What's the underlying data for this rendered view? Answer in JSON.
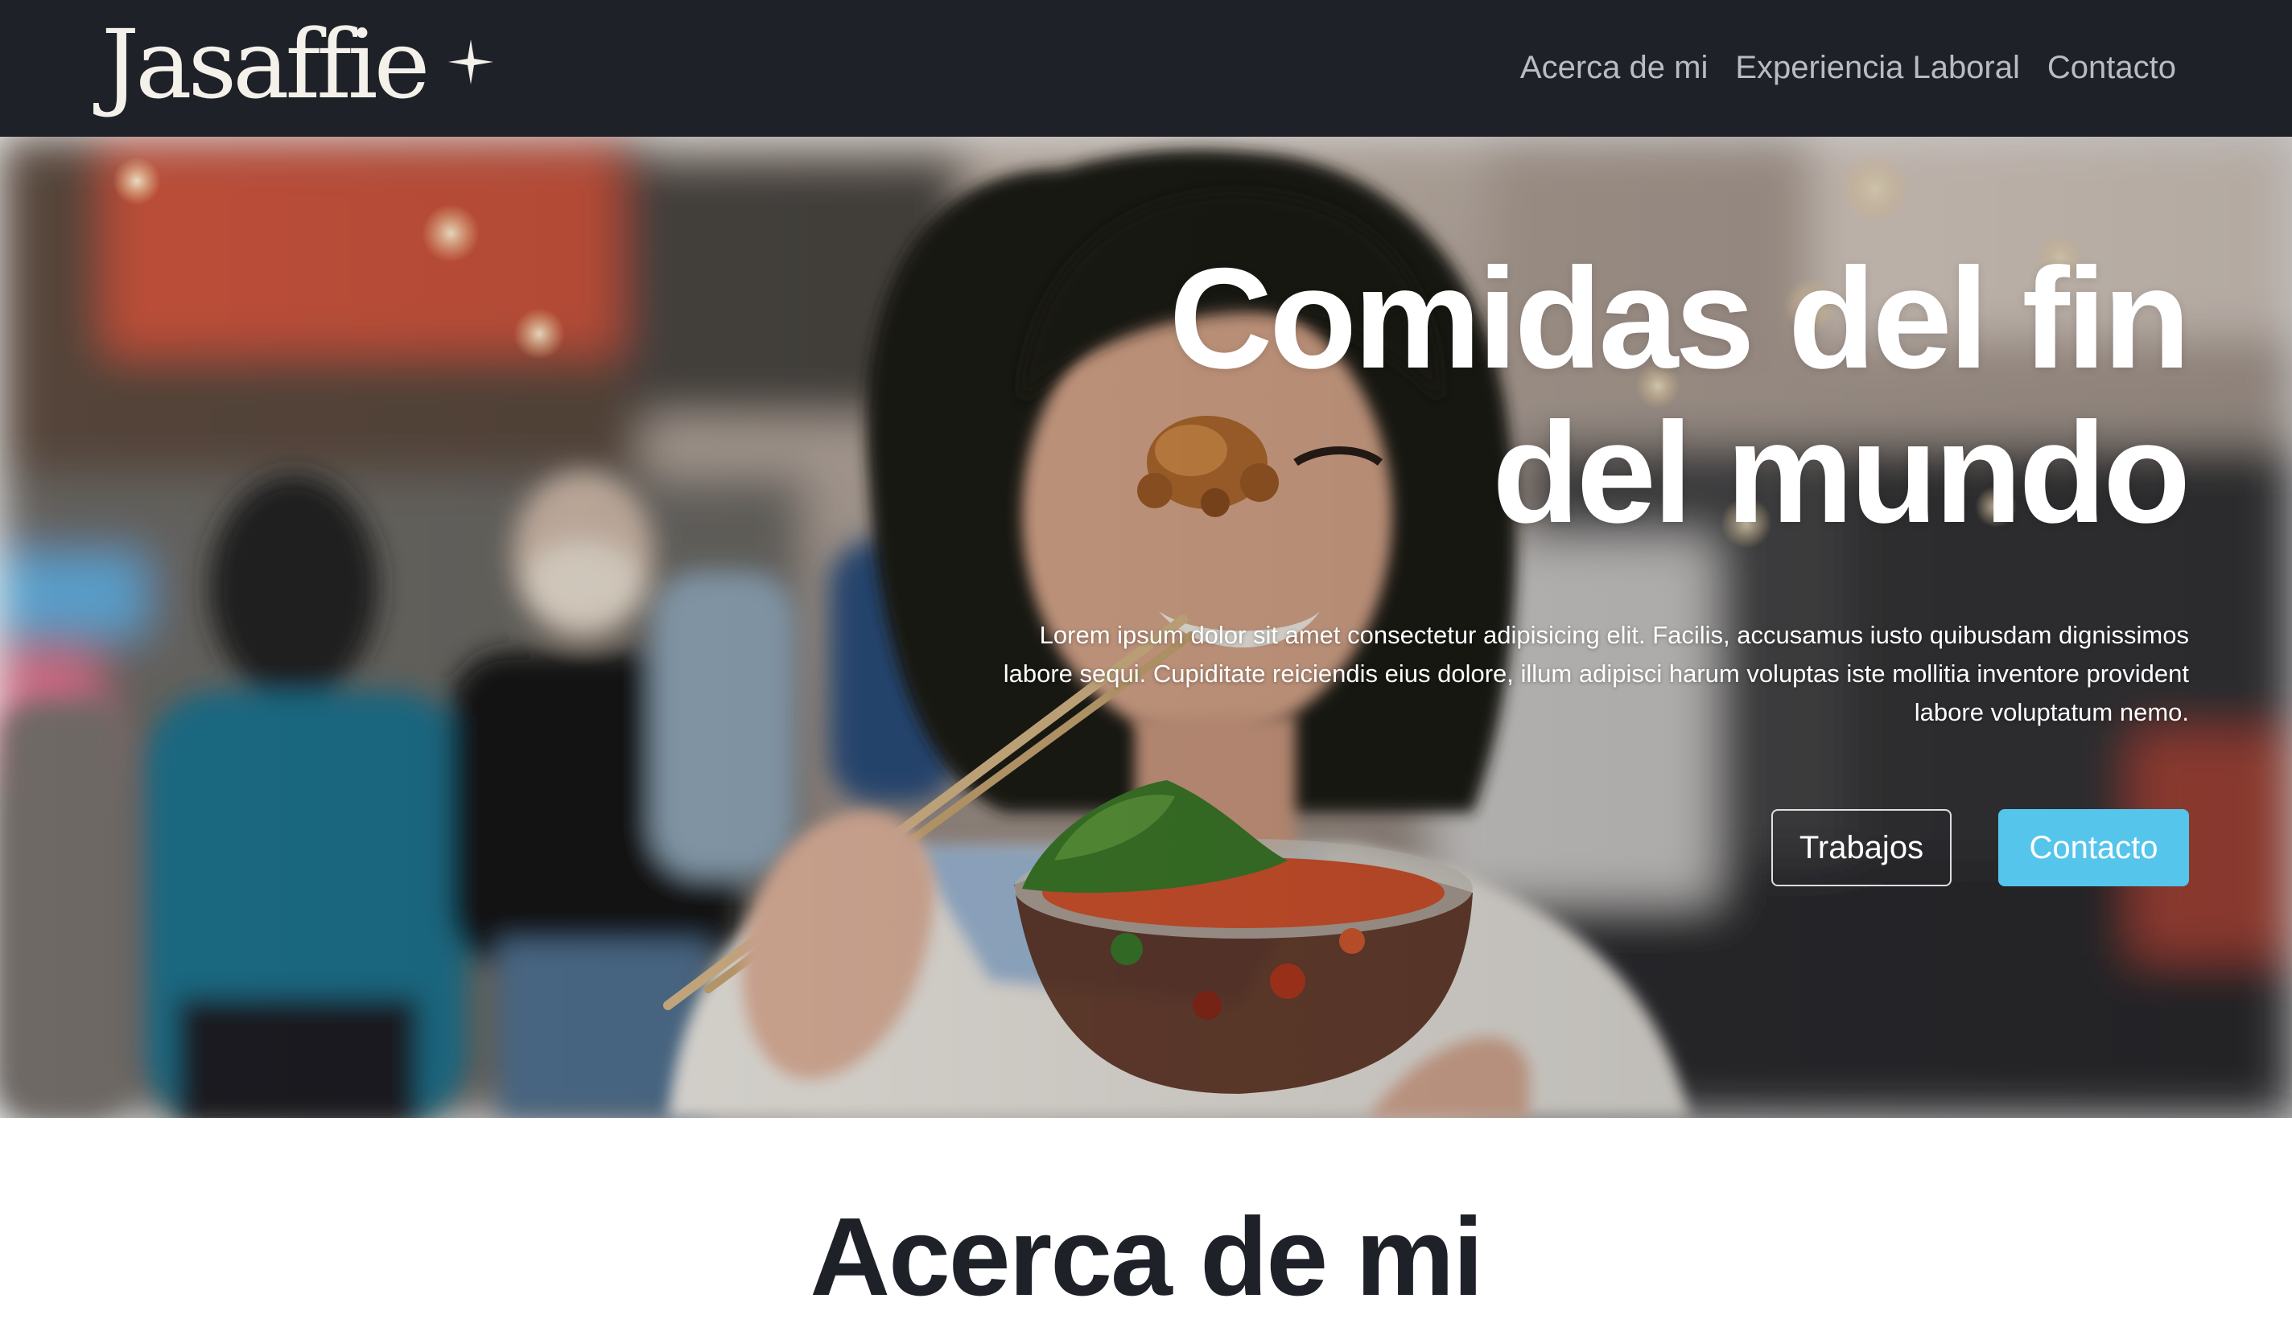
{
  "brand": {
    "name": "Jasaffie",
    "icon": "sparkle-icon"
  },
  "nav": {
    "items": [
      {
        "label": "Acerca de mi"
      },
      {
        "label": "Experiencia Laboral"
      },
      {
        "label": "Contacto"
      }
    ]
  },
  "hero": {
    "image": "hero-street-food-photo",
    "title_line1": "Comidas del fin",
    "title_line2": "del mundo",
    "description": "Lorem ipsum dolor sit amet consectetur adipisicing elit. Facilis, accusamus iusto quibusdam dignissimos labore sequi. Cupiditate reiciendis eius dolore, illum adipisci harum voluptas iste mollitia inventore provident labore voluptatum nemo.",
    "buttons": {
      "secondary_label": "Trabajos",
      "primary_label": "Contacto"
    }
  },
  "about": {
    "title": "Acerca de mi"
  },
  "colors": {
    "navbar_bg": "#1f2129",
    "accent": "#55c5ec",
    "heading_dark": "#1f2129"
  }
}
